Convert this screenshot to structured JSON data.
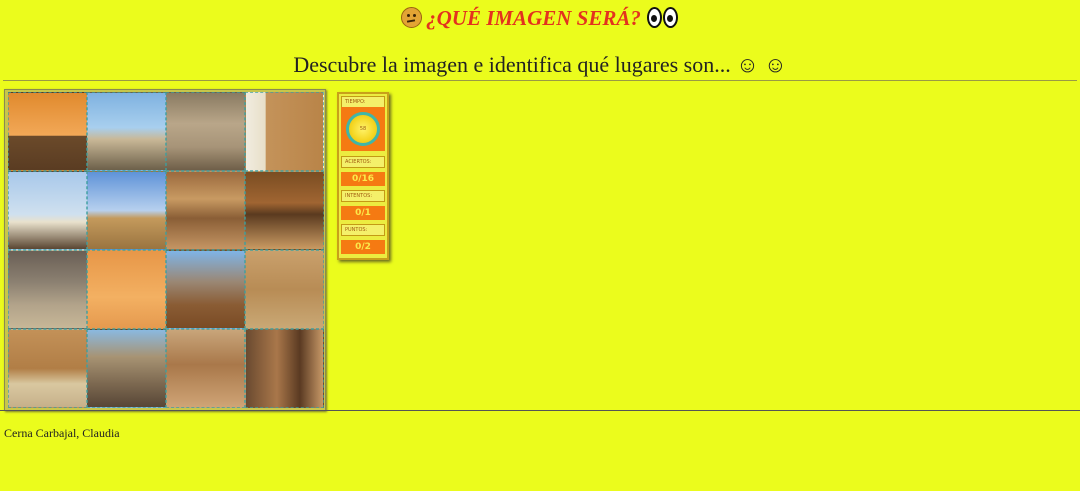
{
  "header": {
    "title": "¿QUÉ IMAGEN SERÁ?",
    "title_icon_left": "thinking-face-icon",
    "title_icon_right": "eyes-icon",
    "subtitle": "Descubre la imagen e identifica qué lugares son... ☺ ☺"
  },
  "board": {
    "rows": 4,
    "columns": 4,
    "tiles": [
      "sunset-with-totem",
      "coastal-cliff",
      "adobe-wall-ruins",
      "adobe-wall-with-statue",
      "white-dome-tent",
      "adobe-wall-blue-sky",
      "visitors-walking",
      "wooden-boardwalk",
      "sand-hill-ground",
      "totem-silhouette-sunset",
      "rocky-hill-shelter",
      "carved-relief-wall",
      "carved-frieze-wall",
      "hill-with-ruins",
      "excavation-site",
      "wooden-posts-walkway"
    ]
  },
  "stats": {
    "time_label": "TIEMPO:",
    "time_value": "58",
    "hits_label": "ACIERTOS:",
    "hits_value": "0/16",
    "attempts_label": "INTENTOS:",
    "attempts_value": "0/1",
    "points_label": "PUNTOS:",
    "points_value": "0/2"
  },
  "colors": {
    "background": "#ebfc1c",
    "title_red": "#e3321e",
    "panel_orange": "#f57a12",
    "timer_ring": "#3fb6a8"
  },
  "footer": {
    "author": "Cerna Carbajal, Claudia"
  }
}
